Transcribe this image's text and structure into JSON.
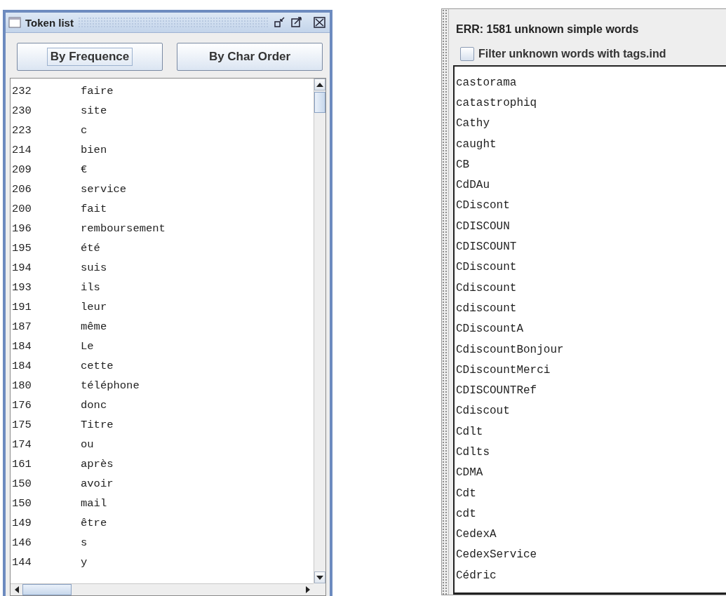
{
  "token_window": {
    "title": "Token list",
    "buttons": [
      {
        "label": "By Frequence",
        "focused": true
      },
      {
        "label": "By Char Order",
        "focused": false
      }
    ],
    "rows": [
      {
        "count": "232",
        "token": "faire"
      },
      {
        "count": "230",
        "token": "site"
      },
      {
        "count": "223",
        "token": "c"
      },
      {
        "count": "214",
        "token": "bien"
      },
      {
        "count": "209",
        "token": "€"
      },
      {
        "count": "206",
        "token": "service"
      },
      {
        "count": "200",
        "token": "fait"
      },
      {
        "count": "196",
        "token": "remboursement"
      },
      {
        "count": "195",
        "token": "été"
      },
      {
        "count": "194",
        "token": "suis"
      },
      {
        "count": "193",
        "token": "ils"
      },
      {
        "count": "191",
        "token": "leur"
      },
      {
        "count": "187",
        "token": "même"
      },
      {
        "count": "184",
        "token": "Le"
      },
      {
        "count": "184",
        "token": "cette"
      },
      {
        "count": "180",
        "token": "téléphone"
      },
      {
        "count": "176",
        "token": "donc"
      },
      {
        "count": "175",
        "token": "Titre"
      },
      {
        "count": "174",
        "token": "ou"
      },
      {
        "count": "161",
        "token": "après"
      },
      {
        "count": "150",
        "token": "avoir"
      },
      {
        "count": "150",
        "token": "mail"
      },
      {
        "count": "149",
        "token": "être"
      },
      {
        "count": "146",
        "token": "s"
      },
      {
        "count": "144",
        "token": "y"
      }
    ]
  },
  "unknown_panel": {
    "header": "ERR: 1581 unknown simple words",
    "filter": {
      "label": "Filter unknown words with tags.ind",
      "checked": false
    },
    "words": [
      "castorama",
      "catastrophiq",
      "Cathy",
      "caught",
      "CB",
      "CdDAu",
      "CDiscont",
      "CDISCOUN",
      "CDISCOUNT",
      "CDiscount",
      "Cdiscount",
      "cdiscount",
      "CDiscountA",
      "CdiscountBonjour",
      "CDiscountMerci",
      "CDISCOUNTRef",
      "Cdiscout",
      "Cdlt",
      "Cdlts",
      "CDMA",
      "Cdt",
      "cdt",
      "CedexA",
      "CedexService",
      "Cédric"
    ]
  }
}
